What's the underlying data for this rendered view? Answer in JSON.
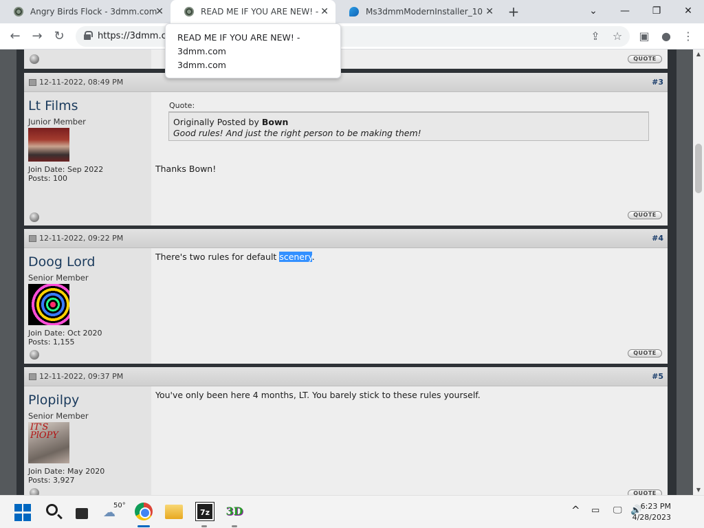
{
  "browser": {
    "tabs": [
      {
        "title": "Angry Birds Flock - 3dmm.com",
        "icon": "globe-icon",
        "active": false
      },
      {
        "title": "READ ME IF YOU ARE NEW! - 3dmm.com",
        "icon": "globe-icon",
        "active": true
      },
      {
        "title": "Ms3dmmModernInstaller_10",
        "icon": "edge-icon",
        "active": false
      }
    ],
    "new_tab_label": "+",
    "window_controls": {
      "dropdown": "⌄",
      "minimize": "—",
      "restore": "❐",
      "close": "✕"
    },
    "nav": {
      "back": "←",
      "forward": "→",
      "reload": "↻"
    },
    "url": "https://3dmm.com",
    "tooltip": {
      "line1": "READ ME IF YOU ARE NEW! -",
      "line2": "3dmm.com",
      "line3": "3dmm.com"
    },
    "toolbar_icons": {
      "share": "⇪",
      "star": "☆",
      "sidepanel": "▣",
      "profile": "●",
      "menu": "⋮"
    }
  },
  "posts": [
    {
      "date": "12-11-2022, 08:49 PM",
      "number": "#3",
      "username": "Lt Films",
      "usertitle": "Junior Member",
      "join_date": "Join Date: Sep 2022",
      "posts": "Posts: 100",
      "quote": {
        "label": "Quote:",
        "posted_by_prefix": "Originally Posted by ",
        "author": "Bown",
        "text": "Good rules! And just the right person to be making them!"
      },
      "message": "Thanks Bown!"
    },
    {
      "date": "12-11-2022, 09:22 PM",
      "number": "#4",
      "username": "Doog Lord",
      "usertitle": "Senior Member",
      "join_date": "Join Date: Oct 2020",
      "posts": "Posts: 1,155",
      "message_before": "There's two rules for default ",
      "message_highlight": "scenery",
      "message_after": "."
    },
    {
      "date": "12-11-2022, 09:37 PM",
      "number": "#5",
      "username": "Plopilpy",
      "usertitle": "Senior Member",
      "join_date": "Join Date: May 2020",
      "posts": "Posts: 3,927",
      "avatar_scrawl": "IT'S PlOPY",
      "message": "You've only been here 4 months, LT. You barely stick to these rules yourself."
    }
  ],
  "quote_button_label": "QUOTE",
  "taskbar": {
    "weather_temp": "50°",
    "sevenzip_label": "7z",
    "threedmm_label": "3D",
    "tray_chevron": "^",
    "time": "6:23 PM",
    "date": "4/28/2023"
  },
  "colors": {
    "highlight": "#3390ff",
    "username": "#1a3a5c",
    "post_number": "#1a3d6b"
  }
}
